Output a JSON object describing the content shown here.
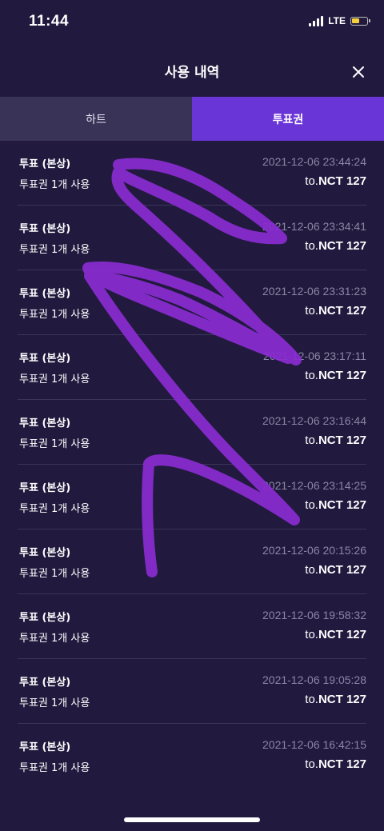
{
  "status_bar": {
    "time": "11:44",
    "network": "LTE",
    "battery_color": "#f7cf3c"
  },
  "header": {
    "title": "사용 내역",
    "close_icon": "close-icon"
  },
  "tabs": [
    {
      "label": "하트",
      "active": false
    },
    {
      "label": "투표권",
      "active": true
    }
  ],
  "accent_color": "#6a35d6",
  "annotation_color": "#8a2bd0",
  "entries": [
    {
      "title": "투표 (본상)",
      "desc": "투표권 1개 사용",
      "time": "2021-12-06 23:44:24",
      "to": "to.",
      "name": "NCT 127"
    },
    {
      "title": "투표 (본상)",
      "desc": "투표권 1개 사용",
      "time": "2021-12-06 23:34:41",
      "to": "to.",
      "name": "NCT 127"
    },
    {
      "title": "투표 (본상)",
      "desc": "투표권 1개 사용",
      "time": "2021-12-06 23:31:23",
      "to": "to.",
      "name": "NCT 127"
    },
    {
      "title": "투표 (본상)",
      "desc": "투표권 1개 사용",
      "time": "2021-12-06 23:17:11",
      "to": "to.",
      "name": "NCT 127"
    },
    {
      "title": "투표 (본상)",
      "desc": "투표권 1개 사용",
      "time": "2021-12-06 23:16:44",
      "to": "to.",
      "name": "NCT 127"
    },
    {
      "title": "투표 (본상)",
      "desc": "투표권 1개 사용",
      "time": "2021-12-06 23:14:25",
      "to": "to.",
      "name": "NCT 127"
    },
    {
      "title": "투표 (본상)",
      "desc": "투표권 1개 사용",
      "time": "2021-12-06 20:15:26",
      "to": "to.",
      "name": "NCT 127"
    },
    {
      "title": "투표 (본상)",
      "desc": "투표권 1개 사용",
      "time": "2021-12-06 19:58:32",
      "to": "to.",
      "name": "NCT 127"
    },
    {
      "title": "투표 (본상)",
      "desc": "투표권 1개 사용",
      "time": "2021-12-06 19:05:28",
      "to": "to.",
      "name": "NCT 127"
    },
    {
      "title": "투표 (본상)",
      "desc": "투표권 1개 사용",
      "time": "2021-12-06 16:42:15",
      "to": "to.",
      "name": "NCT 127"
    }
  ]
}
